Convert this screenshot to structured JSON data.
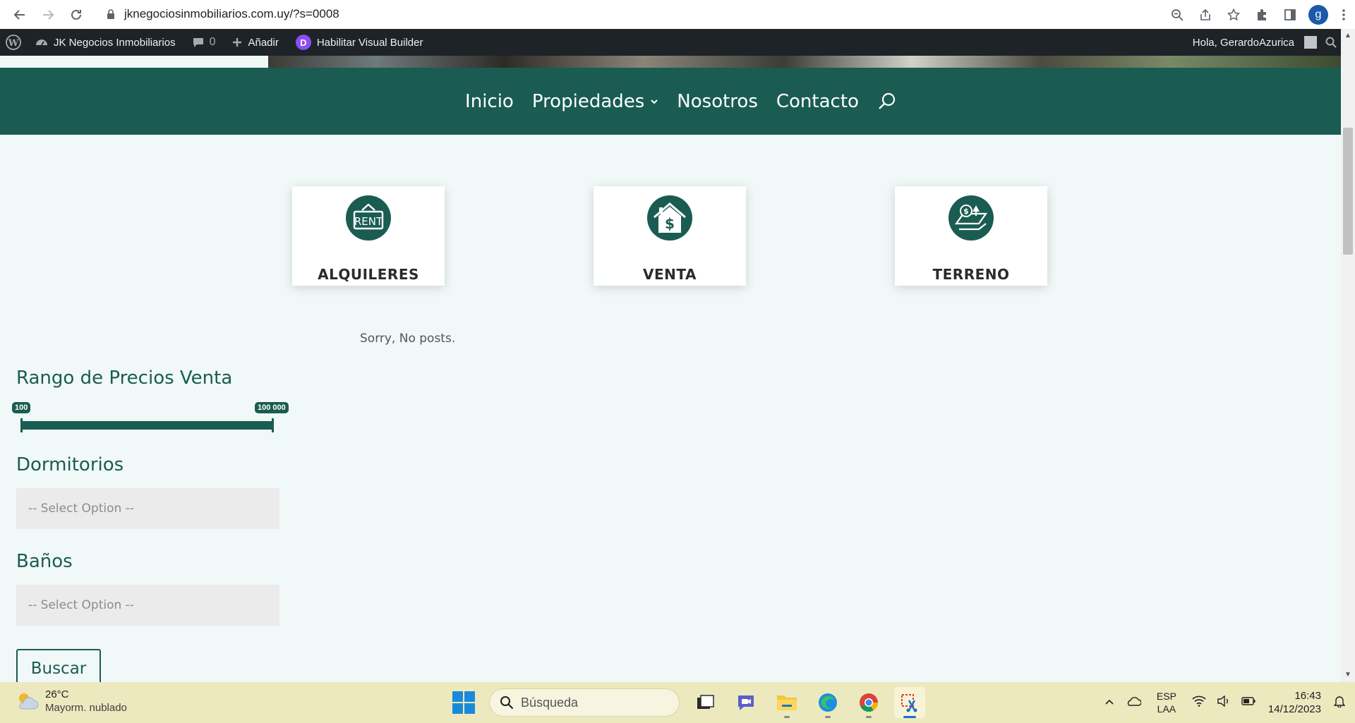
{
  "browser": {
    "url": "jknegociosinmobiliarios.com.uy/?s=0008",
    "profile_initial": "g"
  },
  "adminbar": {
    "site_name": "JK Negocios Inmobiliarios",
    "comments_count": "0",
    "add_label": "Añadir",
    "divi_letter": "D",
    "visual_builder_label": "Habilitar Visual Builder",
    "greeting": "Hola, GerardoAzurica"
  },
  "nav": {
    "items": [
      {
        "label": "Inicio"
      },
      {
        "label": "Propiedades"
      },
      {
        "label": "Nosotros"
      },
      {
        "label": "Contacto"
      }
    ]
  },
  "categories": [
    {
      "label": "ALQUILERES",
      "icon": "rent-sign-icon",
      "icon_text": "RENT"
    },
    {
      "label": "VENTA",
      "icon": "house-dollar-icon"
    },
    {
      "label": "TERRENO",
      "icon": "land-plot-icon"
    }
  ],
  "results": {
    "empty_message": "Sorry, No posts."
  },
  "filters": {
    "price_title": "Rango de Precios Venta",
    "price_min": "100",
    "price_max": "100 000",
    "bedrooms_title": "Dormitorios",
    "bedrooms_placeholder": "-- Select Option --",
    "baths_title": "Baños",
    "baths_placeholder": "-- Select Option --",
    "search_button": "Buscar"
  },
  "colors": {
    "brand": "#1a5c52",
    "page_bg": "#f1f8f8"
  },
  "taskbar": {
    "temperature": "26°C",
    "weather": "Mayorm. nublado",
    "search_placeholder": "Búsqueda",
    "lang_top": "ESP",
    "lang_bottom": "LAA",
    "time": "16:43",
    "date": "14/12/2023"
  }
}
